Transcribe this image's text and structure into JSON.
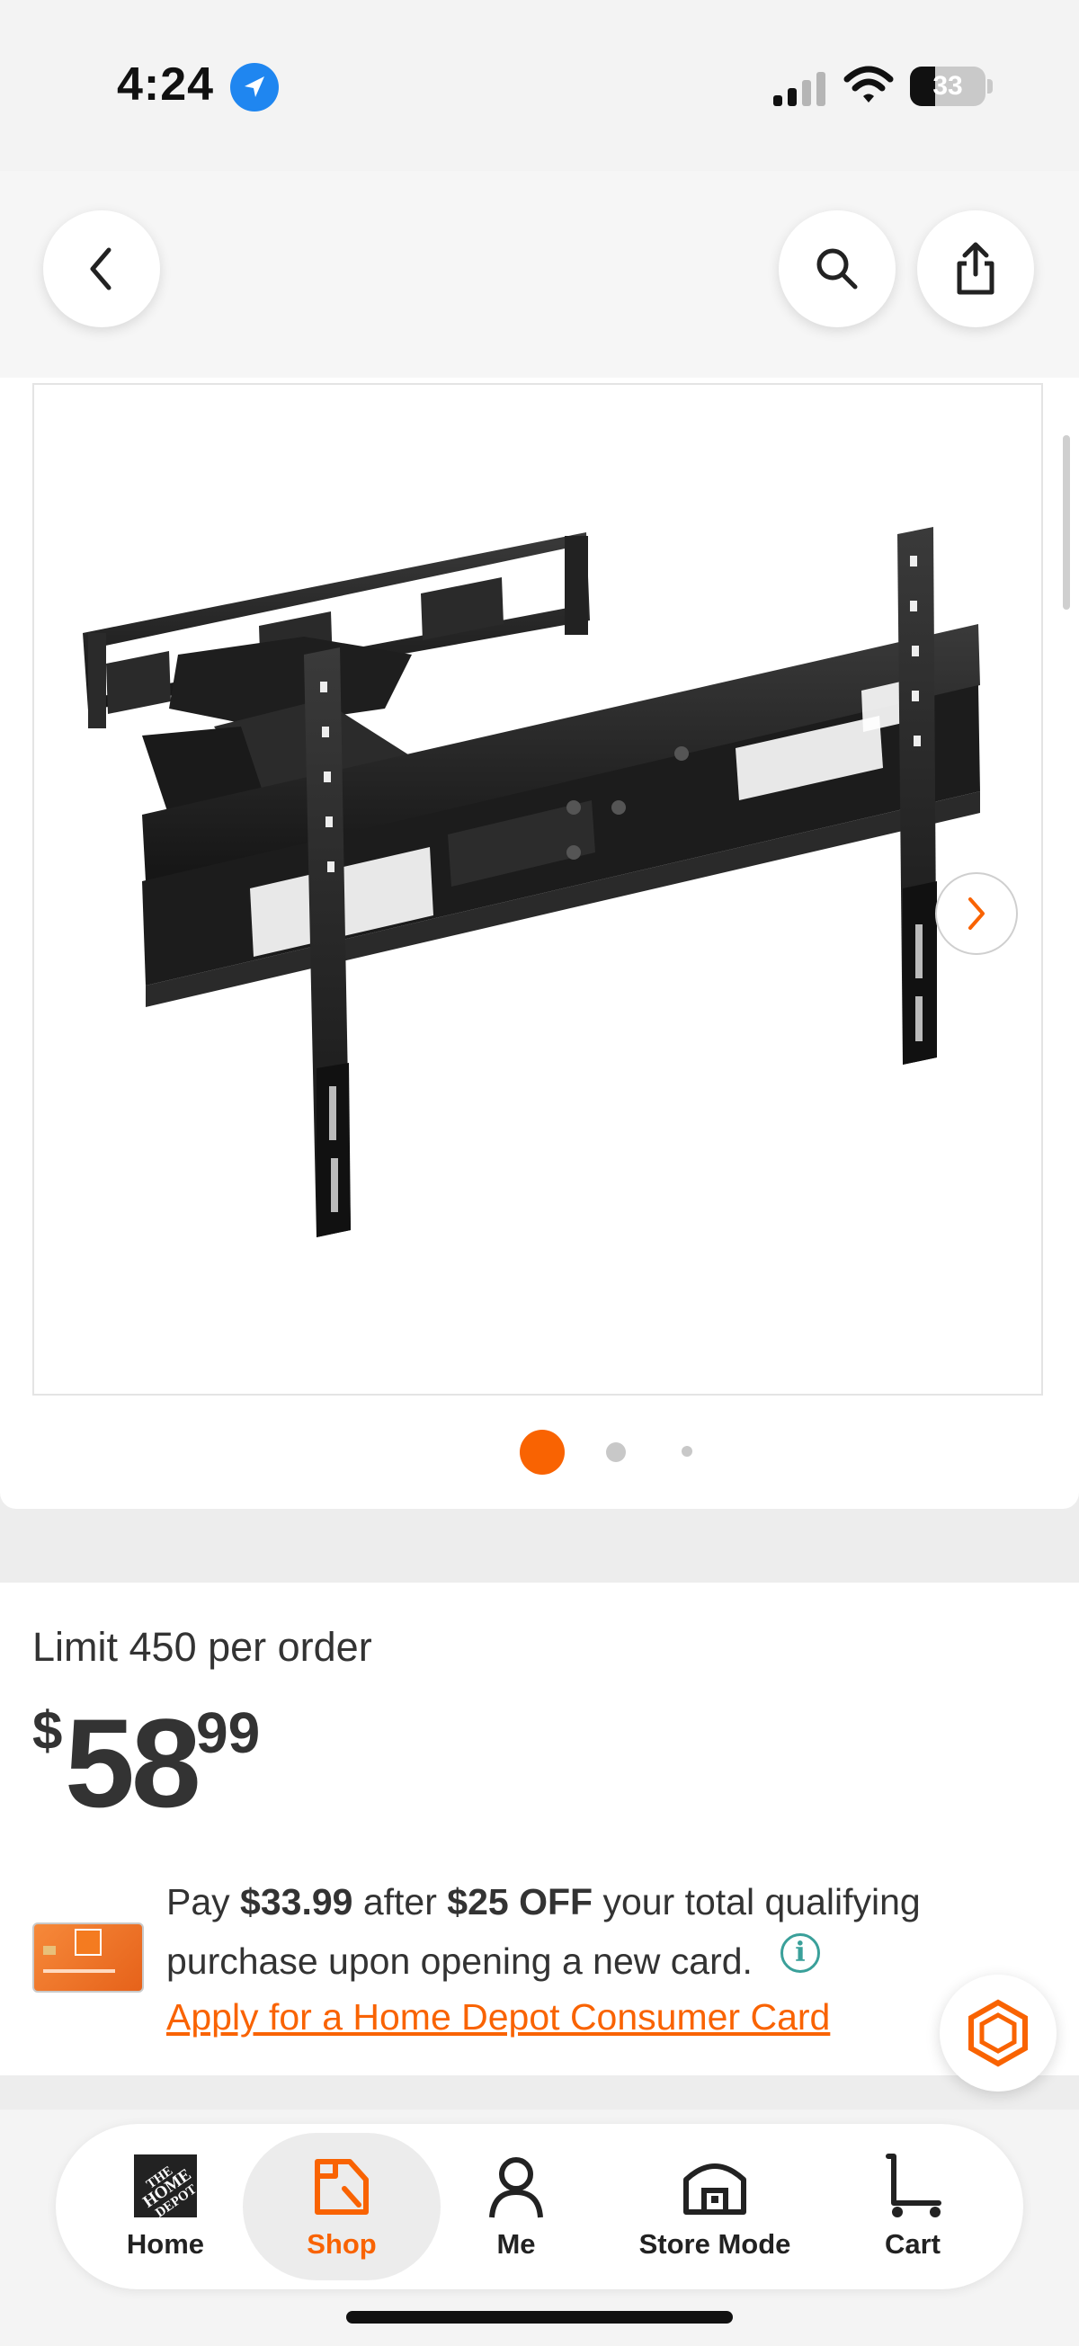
{
  "status_bar": {
    "time": "4:24",
    "battery": "33",
    "battery_level": 0.33
  },
  "gallery": {
    "image_alt": "Full motion TV wall mount",
    "dots": [
      {
        "active": true
      },
      {
        "active": false
      },
      {
        "active": false
      }
    ]
  },
  "product": {
    "limit_text": "Limit 450 per order",
    "price": {
      "currency": "$",
      "dollars": "58",
      "cents": "99"
    }
  },
  "offer": {
    "text_pay": "Pay ",
    "amount_after": "$33.99",
    "text_after": " after ",
    "discount": "$25 OFF",
    "text_rest": " your total qualifying",
    "line2": "purchase upon opening a new card.",
    "link": "Apply for a Home Depot Consumer Card"
  },
  "tab_bar": {
    "items": [
      {
        "label": "Home",
        "icon": "home-depot-logo-icon",
        "active": false
      },
      {
        "label": "Shop",
        "icon": "shop-icon",
        "active": true
      },
      {
        "label": "Me",
        "icon": "person-icon",
        "active": false
      },
      {
        "label": "Store Mode",
        "icon": "store-icon",
        "active": false
      },
      {
        "label": "Cart",
        "icon": "cart-icon",
        "active": false
      }
    ]
  },
  "colors": {
    "accent": "#f96302",
    "info": "#3aa09a",
    "location": "#1f86f0"
  }
}
